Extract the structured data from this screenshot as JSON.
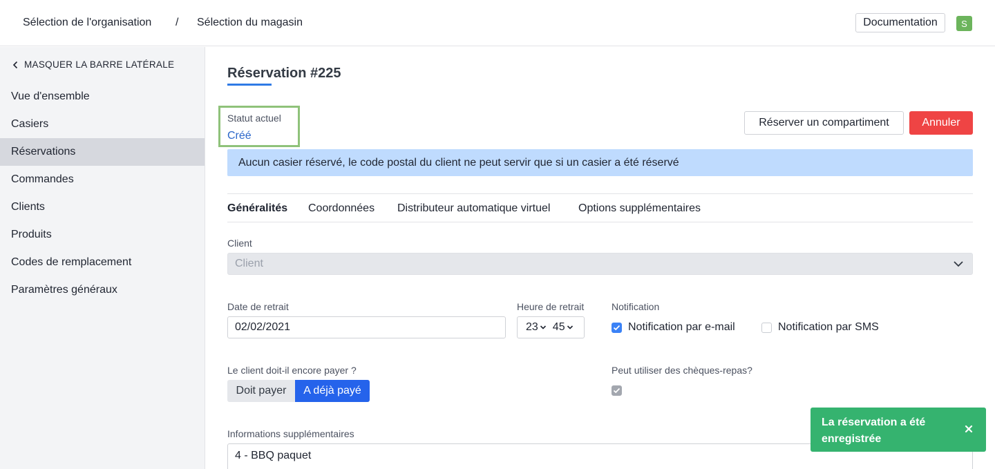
{
  "header": {
    "breadcrumb_org": "Sélection de l'organisation",
    "breadcrumb_sep": "/",
    "breadcrumb_store": "Sélection du magasin",
    "documentation_label": "Documentation",
    "avatar_initial": "S"
  },
  "sidebar": {
    "hide_label": "MASQUER LA BARRE LATÉRALE",
    "items": [
      {
        "label": "Vue d'ensemble"
      },
      {
        "label": "Casiers"
      },
      {
        "label": "Réservations"
      },
      {
        "label": "Commandes"
      },
      {
        "label": "Clients"
      },
      {
        "label": "Produits"
      },
      {
        "label": "Codes de remplacement"
      },
      {
        "label": "Paramètres généraux"
      }
    ],
    "active_item": "Réservations"
  },
  "main": {
    "title": "Réservation #225",
    "status": {
      "label": "Statut actuel",
      "value": "Créé"
    },
    "reserve_button": "Réserver un compartiment",
    "cancel_button": "Annuler",
    "banner": "Aucun casier réservé, le code postal du client ne peut servir que si un casier a été réservé",
    "tabs": [
      {
        "label": "Généralités"
      },
      {
        "label": "Coordonnées"
      },
      {
        "label": "Distributeur automatique virtuel"
      },
      {
        "label": "Options supplémentaires"
      }
    ],
    "active_tab": "Généralités",
    "client": {
      "label": "Client",
      "placeholder": "Client"
    },
    "pickup_date": {
      "label": "Date de retrait",
      "value": "02/02/2021"
    },
    "pickup_time": {
      "label": "Heure de retrait",
      "hour": "23",
      "minute": "45"
    },
    "notification": {
      "label": "Notification",
      "email_label": "Notification par e-mail",
      "email_checked": true,
      "sms_label": "Notification par SMS",
      "sms_checked": false
    },
    "payment": {
      "label": "Le client doit-il encore payer ?",
      "option_due": "Doit payer",
      "option_paid": "A déjà payé",
      "selected": "A déjà payé"
    },
    "meal_vouchers": {
      "label": "Peut utiliser des chèques-repas?",
      "checked": true
    },
    "extra_info": {
      "label": "Informations supplémentaires",
      "value": "4 - BBQ paquet"
    }
  },
  "toast": {
    "message": "La réservation a été enregistrée"
  },
  "colors": {
    "accent_blue": "#2563eb",
    "danger_red": "#ef4444",
    "success_green": "#35b36f",
    "status_highlight": "#8fc27a",
    "banner_blue": "#bfdbfe"
  }
}
